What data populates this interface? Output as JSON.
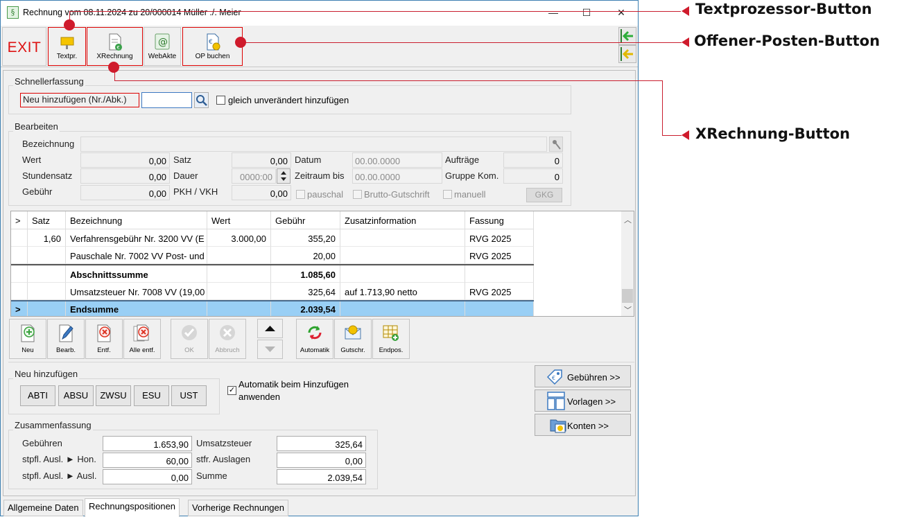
{
  "window": {
    "title": "Rechnung vom 08.11.2024 zu 20/000014  Müller ./. Meier",
    "app_icon": "§",
    "minimize": "—",
    "maximize": "☐",
    "close": "✕"
  },
  "toolbar": {
    "exit": "EXIT",
    "textpr": "Textpr.",
    "xrechnung": "XRechnung",
    "webakte": "WebAkte",
    "op_buchen": "OP buchen"
  },
  "schnellerfassung": {
    "title": "Schnellerfassung",
    "add_label": "Neu hinzufügen (Nr./Abk.)",
    "input_value": "",
    "checkbox_label": "gleich unverändert hinzufügen",
    "checkbox_checked": false
  },
  "bearbeiten": {
    "title": "Bearbeiten",
    "bezeichnung_label": "Bezeichnung",
    "bezeichnung_value": "",
    "wert_label": "Wert",
    "wert_value": "0,00",
    "stundensatz_label": "Stundensatz",
    "stundensatz_value": "0,00",
    "gebuehr_label": "Gebühr",
    "gebuehr_value": "0,00",
    "satz_label": "Satz",
    "satz_value": "0,00",
    "dauer_label": "Dauer",
    "dauer_value": "0000:00",
    "pkh_label": "PKH / VKH",
    "pkh_value": "0,00",
    "datum_label": "Datum",
    "datum_value": "00.00.0000",
    "zeitraum_label": "Zeitraum bis",
    "zeitraum_value": "00.00.0000",
    "pauschal_label": "pauschal",
    "brutto_label": "Brutto-Gutschrift",
    "auftraege_label": "Aufträge",
    "auftraege_value": "0",
    "gruppe_label": "Gruppe Kom.",
    "gruppe_value": "0",
    "manuell_label": "manuell",
    "gkg_button": "GKG"
  },
  "grid": {
    "headers": [
      ">",
      "Satz",
      "Bezeichnung",
      "Wert",
      "Gebühr",
      "Zusatzinformation",
      "Fassung"
    ],
    "rows": [
      {
        "marker": "",
        "satz": "1,60",
        "bezeichnung": "Verfahrensgebühr Nr. 3200 VV (E",
        "wert": "3.000,00",
        "gebuehr": "355,20",
        "zusatz": "",
        "fassung": "RVG 2025"
      },
      {
        "marker": "",
        "satz": "",
        "bezeichnung": "Pauschale Nr. 7002 VV Post- und",
        "wert": "",
        "gebuehr": "20,00",
        "zusatz": "",
        "fassung": "RVG 2025"
      },
      {
        "marker": "",
        "satz": "",
        "bezeichnung": "Abschnittssumme",
        "wert": "",
        "gebuehr": "1.085,60",
        "zusatz": "",
        "fassung": ""
      },
      {
        "marker": "",
        "satz": "",
        "bezeichnung": "Umsatzsteuer Nr. 7008 VV (19,00",
        "wert": "",
        "gebuehr": "325,64",
        "zusatz": "auf 1.713,90 netto",
        "fassung": "RVG 2025"
      },
      {
        "marker": ">",
        "satz": "",
        "bezeichnung": "Endsumme",
        "wert": "",
        "gebuehr": "2.039,54",
        "zusatz": "",
        "fassung": ""
      }
    ]
  },
  "actions": {
    "neu": "Neu",
    "bearb": "Bearb.",
    "entf": "Entf.",
    "alle_entf": "Alle entf.",
    "ok": "OK",
    "abbruch": "Abbruch",
    "automatik": "Automatik",
    "gutschr": "Gutschr.",
    "endpos": "Endpos."
  },
  "neu_hinzufuegen": {
    "title": "Neu hinzufügen",
    "codes": [
      "ABTI",
      "ABSU",
      "ZWSU",
      "ESU",
      "UST"
    ],
    "automatik_label_1": "Automatik beim Hinzufügen",
    "automatik_label_2": "anwenden",
    "automatik_checked": true
  },
  "nav": {
    "gebuehren": "Gebühren >>",
    "vorlagen": "Vorlagen >>",
    "konten": "Konten >>"
  },
  "zusammenfassung": {
    "title": "Zusammenfassung",
    "gebuehren_label": "Gebühren",
    "gebuehren_value": "1.653,90",
    "stpfl_hon_label": "stpfl. Ausl. ► Hon.",
    "stpfl_hon_value": "60,00",
    "stpfl_ausl_label": "stpfl. Ausl. ► Ausl.",
    "stpfl_ausl_value": "0,00",
    "ust_label": "Umsatzsteuer",
    "ust_value": "325,64",
    "stfr_label": "stfr. Auslagen",
    "stfr_value": "0,00",
    "summe_label": "Summe",
    "summe_value": "2.039,54"
  },
  "tabs": [
    "Allgemeine Daten",
    "Rechnungspositionen",
    "Vorherige Rechnungen"
  ],
  "annotations": {
    "textprozessor": "Textprozessor-Button",
    "offener_posten": "Offener-Posten-Button",
    "xrechnung": "XRechnung-Button",
    "color": "#cf1b2c"
  }
}
